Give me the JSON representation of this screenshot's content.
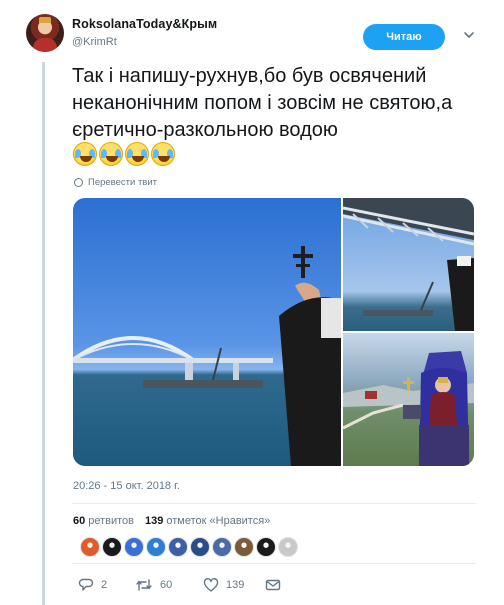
{
  "author": {
    "display_name": "RoksolanaToday&Крым",
    "handle": "@KrimRt",
    "avatar_icon": "avatar-portrait"
  },
  "follow_button": {
    "label": "Читаю"
  },
  "tweet": {
    "text": "Так і напишу-рухнув,бо був освячений неканонічним попом і зовсім не святою,а єретично-разкольною водою",
    "emoji": [
      "rolling-on-floor-laughing-emoji",
      "rolling-on-floor-laughing-emoji",
      "rolling-on-floor-laughing-emoji",
      "rolling-on-floor-laughing-emoji"
    ],
    "translate_label": "Перевести твит",
    "timestamp": "20:26 - 15 окт. 2018 г."
  },
  "media": {
    "photos": [
      "bridge-and-priest-cross-photo",
      "bridge-from-below-photo",
      "balloon-blessing-photo"
    ]
  },
  "stats": {
    "retweets_count": "60",
    "retweets_label": "ретвитов",
    "likes_count": "139",
    "likes_label": "отметок «Нравится»"
  },
  "likers": {
    "colors": [
      "#e25b2a",
      "#1a1a1a",
      "#3a6fd8",
      "#2d7fd6",
      "#3c5fa8",
      "#2a4c8a",
      "#4a6aa8",
      "#7b5a3a",
      "#1b1b1b",
      "#c9c9c9"
    ]
  },
  "actions": {
    "replies": "2",
    "retweets": "60",
    "likes": "139"
  },
  "colors": {
    "accent": "#1da1f2",
    "muted_text": "#657786",
    "border": "#e6ecf0"
  }
}
